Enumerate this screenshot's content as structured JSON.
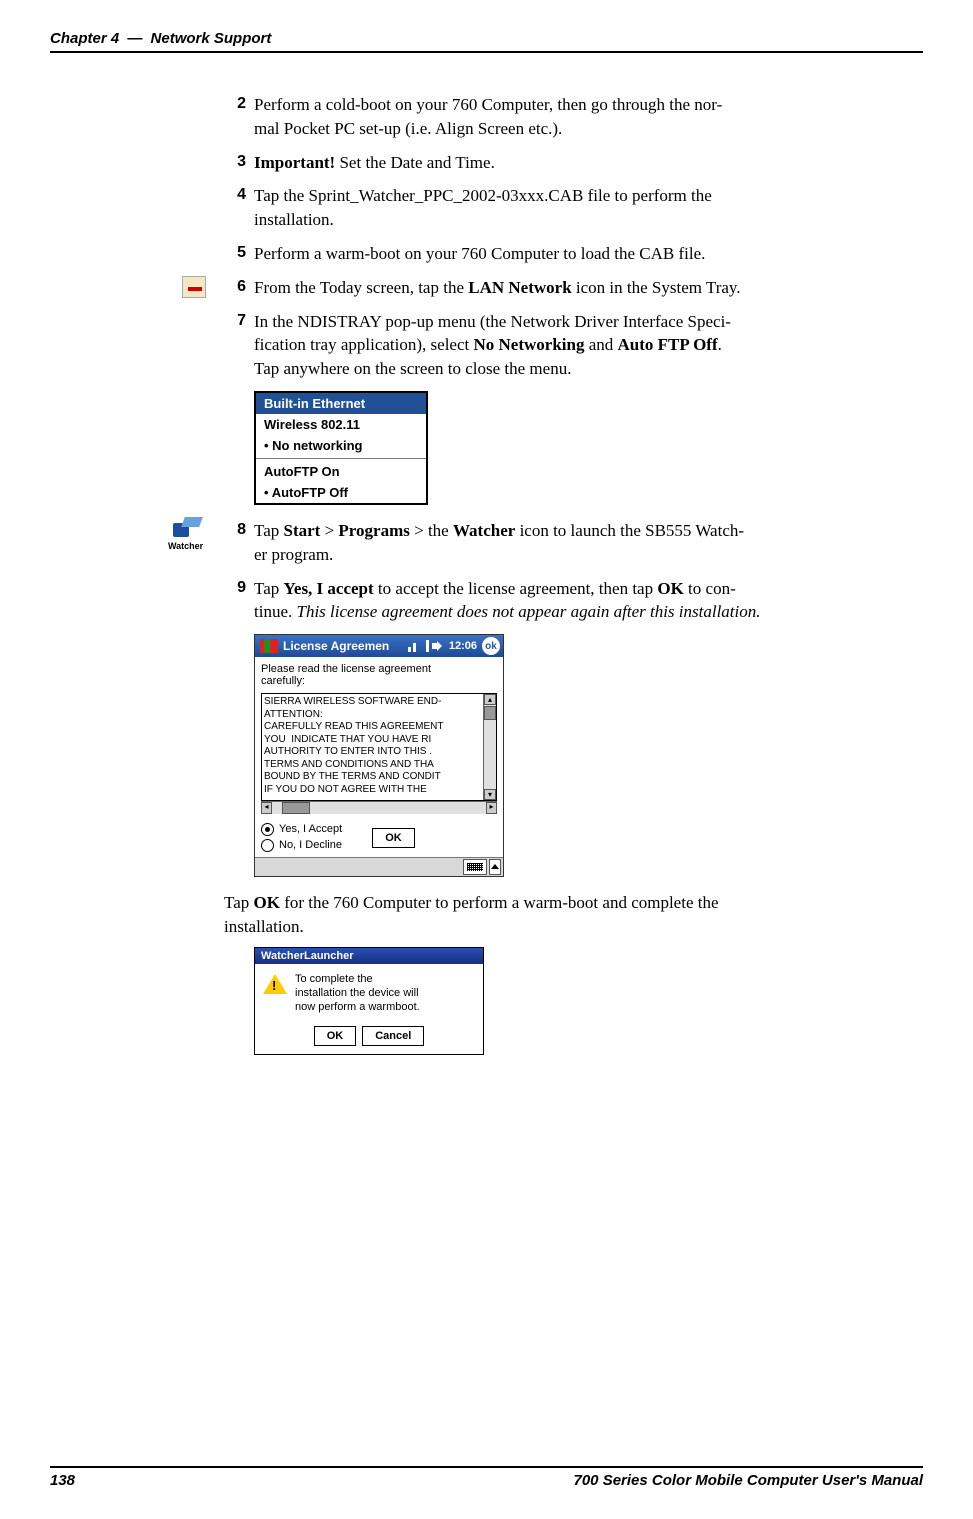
{
  "header": {
    "chapter": "Chapter 4",
    "sep": "—",
    "title": "Network Support"
  },
  "steps": {
    "s2": {
      "num": "2",
      "text_a": "Perform a cold-boot on your 760 Computer, then go through the nor-",
      "text_b": "mal Pocket PC set-up (i.e. Align Screen etc.)."
    },
    "s3": {
      "num": "3",
      "label": "Important!",
      "rest": " Set the Date and Time."
    },
    "s4": {
      "num": "4",
      "text_a": "Tap the Sprint_Watcher_PPC_2002-03xxx.CAB file to perform the",
      "text_b": "installation."
    },
    "s5": {
      "num": "5",
      "text": "Perform a warm-boot on your 760 Computer to load the CAB file."
    },
    "s6": {
      "num": "6",
      "pre": "From the Today screen, tap the ",
      "bold": "LAN Network",
      "post": " icon in the System Tray."
    },
    "s7": {
      "num": "7",
      "line1_a": "In the NDISTRAY pop-up menu (the Network Driver Interface Speci-",
      "line1_b": "fication tray application), select ",
      "bold1": "No Networking",
      "mid": " and ",
      "bold2": "Auto FTP Off",
      "post": ".",
      "line2": "Tap anywhere on the screen to close the menu."
    },
    "s8": {
      "num": "8",
      "pre": "Tap ",
      "b1": "Start",
      "gt1": " > ",
      "b2": "Programs",
      "gt2": " > the ",
      "b3": "Watcher",
      "post": " icon to launch the SB555 Watch-",
      "line2": "er program."
    },
    "s9": {
      "num": "9",
      "pre": "Tap ",
      "b1": "Yes, I accept",
      "mid": " to accept the license agreement, then tap ",
      "b2": "OK",
      "post": " to con-",
      "line2a": "tinue. ",
      "italic": "This license agreement does not appear again after this installation."
    }
  },
  "ndis_menu": {
    "title": "Built-in Ethernet",
    "item1": "Wireless 802.11",
    "item2": "No networking",
    "item3": "AutoFTP On",
    "item4": "AutoFTP Off"
  },
  "watcher_label": "Watcher",
  "license_window": {
    "title": "License Agreemen",
    "time": "12:06",
    "ok_badge": "ok",
    "intro1": "Please read the license agreement",
    "intro2": "carefully:",
    "lines": "SIERRA WIRELESS SOFTWARE END-\nATTENTION:\nCAREFULLY READ THIS AGREEMENT\nYOU  INDICATE THAT YOU HAVE RI\nAUTHORITY TO ENTER INTO THIS .\nTERMS AND CONDITIONS AND THA\nBOUND BY THE TERMS AND CONDIT\nIF YOU DO NOT AGREE WITH THE ",
    "radio_yes": "Yes, I Accept",
    "radio_no": "No, I Decline",
    "ok_btn": "OK"
  },
  "post_para": {
    "pre": "Tap ",
    "b": "OK",
    "post_a": " for the 760 Computer to perform a warm-boot and complete the",
    "post_b": "installation."
  },
  "dialog": {
    "title": "WatcherLauncher",
    "msg1": "To complete the",
    "msg2": "installation the device will",
    "msg3": "now perform a warmboot.",
    "ok": "OK",
    "cancel": "Cancel"
  },
  "footer": {
    "page": "138",
    "title": "700 Series Color Mobile Computer User's Manual"
  }
}
